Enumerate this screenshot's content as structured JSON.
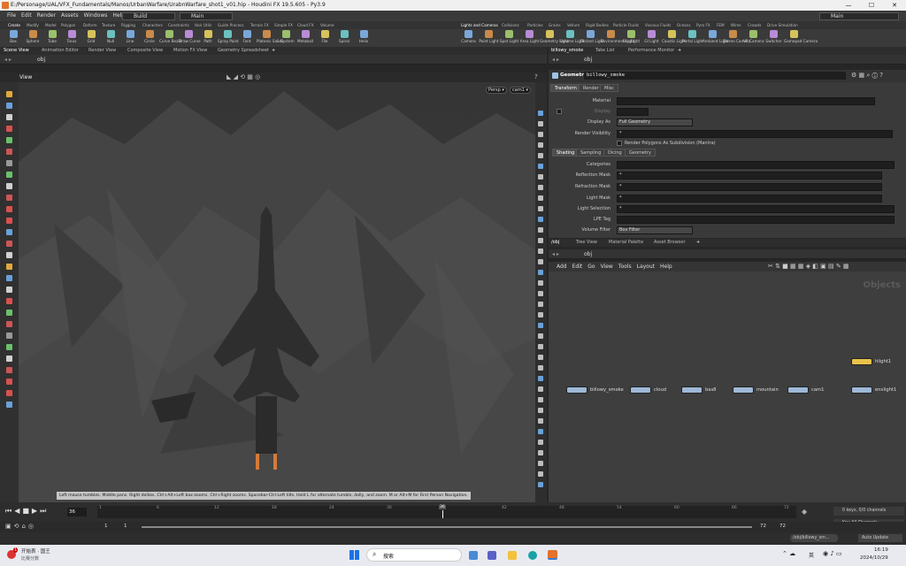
{
  "window": {
    "title": "E:/Personage/UAL/VFX_Fundamentals/Manos/UrbanWarfare/UrabnWarfare_shot1_v01.hip - Houdini FX 19.5.605 - Py3.9",
    "minimize": "—",
    "maximize": "☐",
    "close": "✕"
  },
  "menubar": {
    "items": [
      "File",
      "Edit",
      "Render",
      "Assets",
      "Windows",
      "Help"
    ],
    "desktop": "Build",
    "context": "Main",
    "right_desktop": "Main"
  },
  "shelf": {
    "tabs_left": [
      "Create",
      "Modify",
      "Model",
      "Polygon",
      "Deform",
      "Texture",
      "Rigging",
      "Characters",
      "Constraints",
      "Hair Utils",
      "Guide Process",
      "Terrain FX",
      "Simple FX",
      "Cloud FX",
      "Volume"
    ],
    "tools_left": [
      "Box",
      "Sphere",
      "Tube",
      "Torus",
      "Grid",
      "Null",
      "Line",
      "Circle",
      "Curve Bezier",
      "Draw Curve",
      "Path",
      "Spray Paint",
      "Font",
      "Platonic Solids",
      "L-System",
      "Metaball",
      "File",
      "Spiral",
      "Helix"
    ],
    "tabs_right": [
      "Lights and Cameras",
      "Collisions",
      "Particles",
      "Grains",
      "Vellum",
      "Rigid Bodies",
      "Particle Fluids",
      "Viscous Fluids",
      "Oceans",
      "Pyro FX",
      "FEM",
      "Wires",
      "Crowds",
      "Drive Simulation"
    ],
    "tools_right": [
      "Camera",
      "Point Light",
      "Spot Light",
      "Area Light",
      "Geometry Light",
      "Volume Light",
      "Distant Light",
      "Environment Light",
      "Sky Light",
      "GI Light",
      "Caustic Light",
      "Portal Light",
      "Ambient Light",
      "Stereo Camera",
      "VR Camera",
      "Switcher",
      "Gamepad Camera"
    ]
  },
  "left_panel": {
    "tabs": [
      "Scene View",
      "Animation Editor",
      "Render View",
      "Composite View",
      "Motion FX View",
      "Geometry Spreadsheet"
    ],
    "path": "obj",
    "view_label": "View",
    "persp": "Persp ▾",
    "cam": "cam1 ▾",
    "status_message": "Left mouse tumbles. Middle pans. Right dollies. Ctrl+Alt+Left box-zooms. Ctrl+Right zooms. Spacebar-Ctrl-Left tilts. Hold L for alternate tumble, dolly, and zoom.    M or Alt+M for First Person Navigation."
  },
  "param_panel": {
    "tabs": [
      "billowy_smoke",
      "Take List",
      "Performance Monitor"
    ],
    "path": "obj",
    "node_type": "Geometry",
    "node_name": "billowy_smoke",
    "main_tabs": [
      "Transform",
      "Render",
      "Misc"
    ],
    "rows": [
      {
        "label": "Material",
        "value": ""
      },
      {
        "label": "Display",
        "value": ""
      },
      {
        "label": "Display As",
        "value": "Full Geometry"
      },
      {
        "label": "Render Visibility",
        "value": "*"
      }
    ],
    "checkbox_label": "Render Polygons As Subdivision (Mantra)",
    "sub_tabs": [
      "Shading",
      "Sampling",
      "Dicing",
      "Geometry"
    ],
    "shading_rows": [
      {
        "label": "Categories",
        "value": ""
      },
      {
        "label": "Reflection Mask",
        "value": "*"
      },
      {
        "label": "Refraction Mask",
        "value": "*"
      },
      {
        "label": "Light Mask",
        "value": "*"
      },
      {
        "label": "Light Selection",
        "value": "*"
      },
      {
        "label": "LPE Tag",
        "value": ""
      },
      {
        "label": "Volume Filter",
        "value": "Box Filter"
      }
    ]
  },
  "network_panel": {
    "tabs": [
      "/obj",
      "Tree View",
      "Material Palette",
      "Asset Browser"
    ],
    "path": "obj",
    "menu": [
      "Add",
      "Edit",
      "Go",
      "View",
      "Tools",
      "Layout",
      "Help"
    ],
    "context_label": "Objects",
    "nodes": [
      {
        "name": "billowy_smoke",
        "color": "#9ec3e6"
      },
      {
        "name": "cloud",
        "color": "#9ec3e6"
      },
      {
        "name": "bas8",
        "color": "#9ec3e6"
      },
      {
        "name": "mountain",
        "color": "#9ec3e6"
      },
      {
        "name": "cam1",
        "color": "#9ec3e6"
      },
      {
        "name": "hlight1",
        "color": "#e8c24a"
      },
      {
        "name": "envlight1",
        "color": "#9ec3e6"
      }
    ]
  },
  "timeline": {
    "current_frame": "36",
    "frame_start": "1",
    "frame_start2": "1",
    "frame_end": "72",
    "frame_end2": "72",
    "ticks": [
      "1",
      "6",
      "12",
      "18",
      "24",
      "30",
      "36",
      "42",
      "48",
      "54",
      "60",
      "66",
      "72"
    ],
    "keys_info": "0 keys, 0/0 channels",
    "key_all": "Key All Channels",
    "auto_update": "Auto Update",
    "node_path": "/obj/billowy_sm..."
  },
  "taskbar": {
    "weather": "开始表 · 国王",
    "weather_sub": "比赛分数",
    "search": "搜索",
    "lang": "英",
    "time": "16:19",
    "date": "2024/10/29",
    "notification": "1"
  },
  "colors": {
    "accent": "#e39a35",
    "viewport_bg": "#3b3b3b",
    "node_blue": "#9ec3e6",
    "node_yellow": "#e8c24a"
  }
}
